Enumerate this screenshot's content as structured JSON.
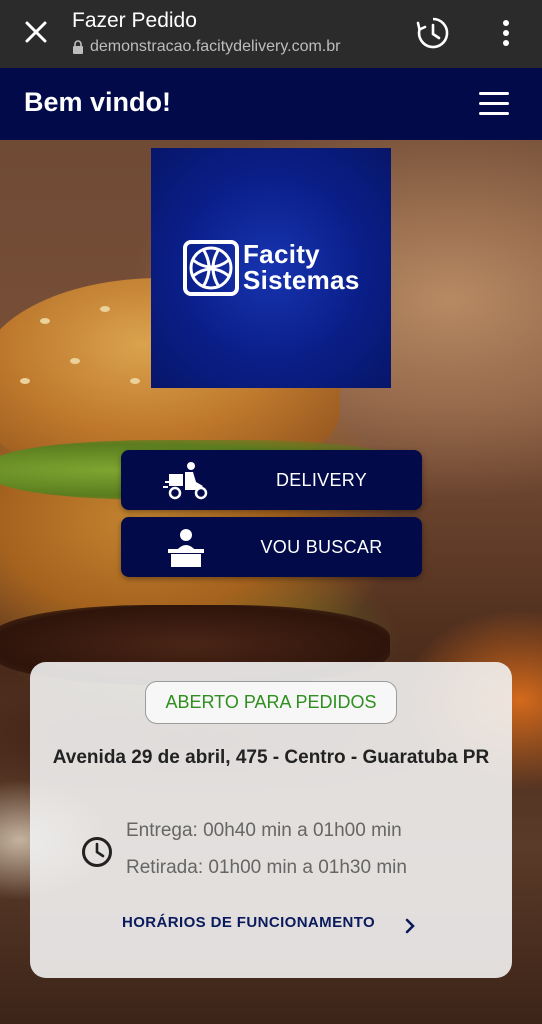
{
  "browser": {
    "title": "Fazer Pedido",
    "url": "demonstracao.facitydelivery.com.br"
  },
  "header": {
    "title": "Bem vindo!"
  },
  "logo": {
    "line1": "Facity",
    "line2": "Sistemas"
  },
  "actions": {
    "delivery_label": "DELIVERY",
    "pickup_label": "VOU BUSCAR"
  },
  "info": {
    "status": "ABERTO PARA PEDIDOS",
    "address": "Avenida 29 de abril, 475 - Centro - Guaratuba PR",
    "delivery_time": "Entrega: 00h40 min a 01h00 min",
    "pickup_time": "Retirada: 01h00 min a 01h30 min",
    "hours_link": "HORÁRIOS DE FUNCIONAMENTO"
  },
  "colors": {
    "primary": "#020a4a",
    "status_green": "#2f8f1f",
    "browser_bar": "#2b2b2b"
  }
}
